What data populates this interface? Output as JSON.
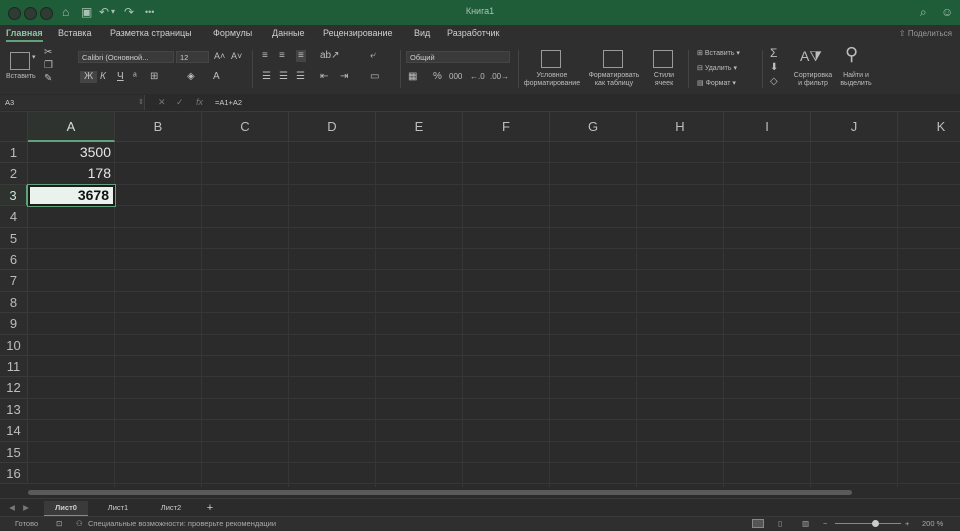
{
  "window": {
    "title": "Книга1"
  },
  "menu": {
    "tabs": [
      "Главная",
      "Вставка",
      "Разметка страницы",
      "Формулы",
      "Данные",
      "Рецензирование",
      "Вид",
      "Разработчик"
    ],
    "share": "Поделиться"
  },
  "ribbon": {
    "paste": "Вставить",
    "font_name": "Calibri (Основной...",
    "font_size": "12",
    "bold": "Ж",
    "italic": "К",
    "underline": "Ч",
    "number_format": "Общий",
    "percent": "%",
    "cond_format_1": "Условное",
    "cond_format_2": "форматирование",
    "format_table_1": "Форматировать",
    "format_table_2": "как таблицу",
    "cell_styles_1": "Стили",
    "cell_styles_2": "ячеек",
    "insert": "Вставить",
    "delete": "Удалить",
    "format": "Формат",
    "sort_1": "Сортировка",
    "sort_2": "и фильтр",
    "find_1": "Найти и",
    "find_2": "выделить",
    "sigma": "Σ"
  },
  "formula_bar": {
    "name_box": "A3",
    "fx": "fx",
    "formula": "=A1+A2"
  },
  "sheet": {
    "columns": [
      "A",
      "B",
      "C",
      "D",
      "E",
      "F",
      "G",
      "H",
      "I",
      "J",
      "K"
    ],
    "rows": [
      "1",
      "2",
      "3",
      "4",
      "5",
      "6",
      "7",
      "8",
      "9",
      "10",
      "11",
      "12",
      "13",
      "14",
      "15",
      "16"
    ],
    "cells": {
      "A1": "3500",
      "A2": "178",
      "A3": "3678"
    }
  },
  "sheet_tabs": {
    "tabs": [
      "Лист0",
      "Лист1",
      "Лист2"
    ],
    "add": "+"
  },
  "status": {
    "ready": "Готово",
    "accessibility": "Специальные возможности: проверьте рекомендации",
    "zoom": "200 %"
  },
  "colors": {
    "accent": "#5ea37a",
    "titlebar": "#1f5c38",
    "active_cell_bg": "#e9f2ec"
  }
}
